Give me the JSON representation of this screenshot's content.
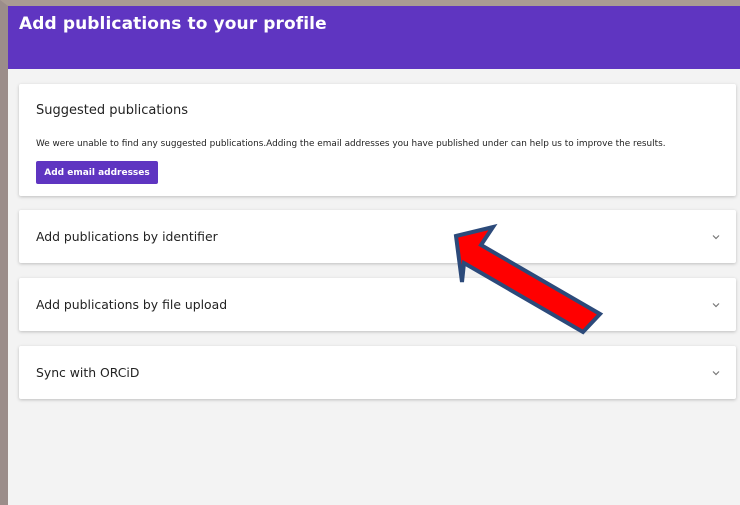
{
  "header": {
    "title": "Add publications to your profile"
  },
  "suggested": {
    "title": "Suggested publications",
    "message": "We were unable to find any suggested publications.Adding the email addresses you have published under can help us to improve the results.",
    "button_label": "Add email addresses"
  },
  "sections": [
    {
      "label": "Add publications by identifier"
    },
    {
      "label": "Add publications by file upload"
    },
    {
      "label": "Sync with ORCiD"
    }
  ],
  "colors": {
    "header_bg": "#5f35c1",
    "button_bg": "#5f35c1",
    "page_bg": "#f3f3f3",
    "annotation_arrow_fill": "#ff0000",
    "annotation_arrow_stroke": "#2c4a7a"
  },
  "icons": {
    "expand": "chevron-down-icon"
  }
}
